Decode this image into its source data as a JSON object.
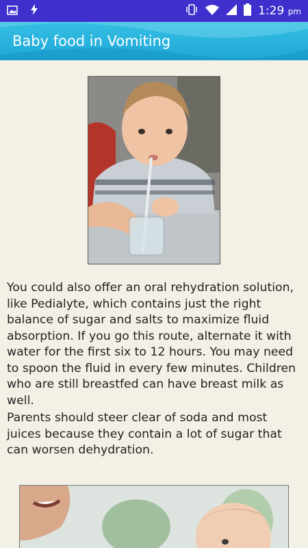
{
  "status_bar": {
    "time": "1:29",
    "ampm": "pm",
    "icons": [
      "image-icon",
      "flash-icon",
      "vibrate-icon",
      "wifi-icon",
      "signal-icon",
      "battery-icon"
    ]
  },
  "app_bar": {
    "title": "Baby food in Vomiting"
  },
  "article": {
    "image1": "baby-drinking-from-glass-with-straw-image",
    "paragraph1": "You could also offer an oral rehydration solution, like Pedialyte, which contains just the right balance of sugar and salts to maximize fluid absorption. If you go this route, alternate it with water for the first six to 12 hours. You may need to spoon the fluid in every few minutes. Children who are still breastfed can have breast milk as well.",
    "paragraph2": "Parents should steer clear of soda and most juices because they contain a lot of sugar that can worsen dehydration.",
    "image2": "parent-feeding-baby-image"
  },
  "colors": {
    "status_bar": "#3f2fcc",
    "app_bar": "#1fa7d8",
    "background": "#f3f1e6",
    "text": "#222222"
  }
}
